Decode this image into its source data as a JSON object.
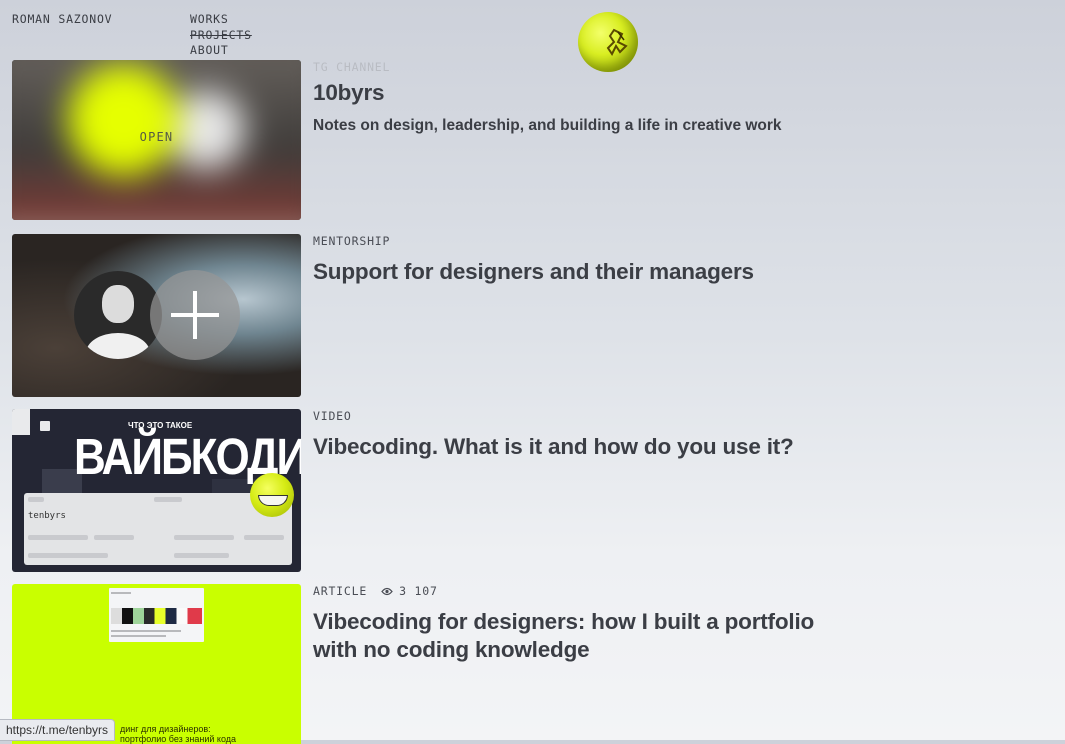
{
  "header": {
    "brand": "ROMAN SAZONOV",
    "nav": [
      {
        "label": "WORKS",
        "struck": false
      },
      {
        "label": "PROJECTS",
        "struck": true
      },
      {
        "label": "ABOUT",
        "struck": false
      }
    ]
  },
  "items": [
    {
      "tag": "TG CHANNEL",
      "title": "10byrs",
      "subtitle": "Notes on design, leadership, and building a life in creative work",
      "overlay": "OPEN"
    },
    {
      "tag": "MENTORSHIP",
      "title": "Support for designers and their managers"
    },
    {
      "tag": "VIDEO",
      "title": "Vibecoding. What is it and how do you use it?",
      "thumb_small": "ЧТО ЭТО ТАКОЕ",
      "thumb_big": "ВАЙБКОДИНГ",
      "thumb_panel": "tenbyrs"
    },
    {
      "tag": "ARTICLE",
      "views": "3 107",
      "title_line1": "Vibecoding for designers: how I built a portfolio",
      "title_line2": "with no coding knowledge",
      "thumb_caption_1": "динг для дизайнеров:",
      "thumb_caption_2": "портфолио без знаний кода"
    }
  ],
  "status_url": "https://t.me/tenbyrs",
  "colors": {
    "accent": "#c9ff00",
    "text": "#3b3e45"
  }
}
